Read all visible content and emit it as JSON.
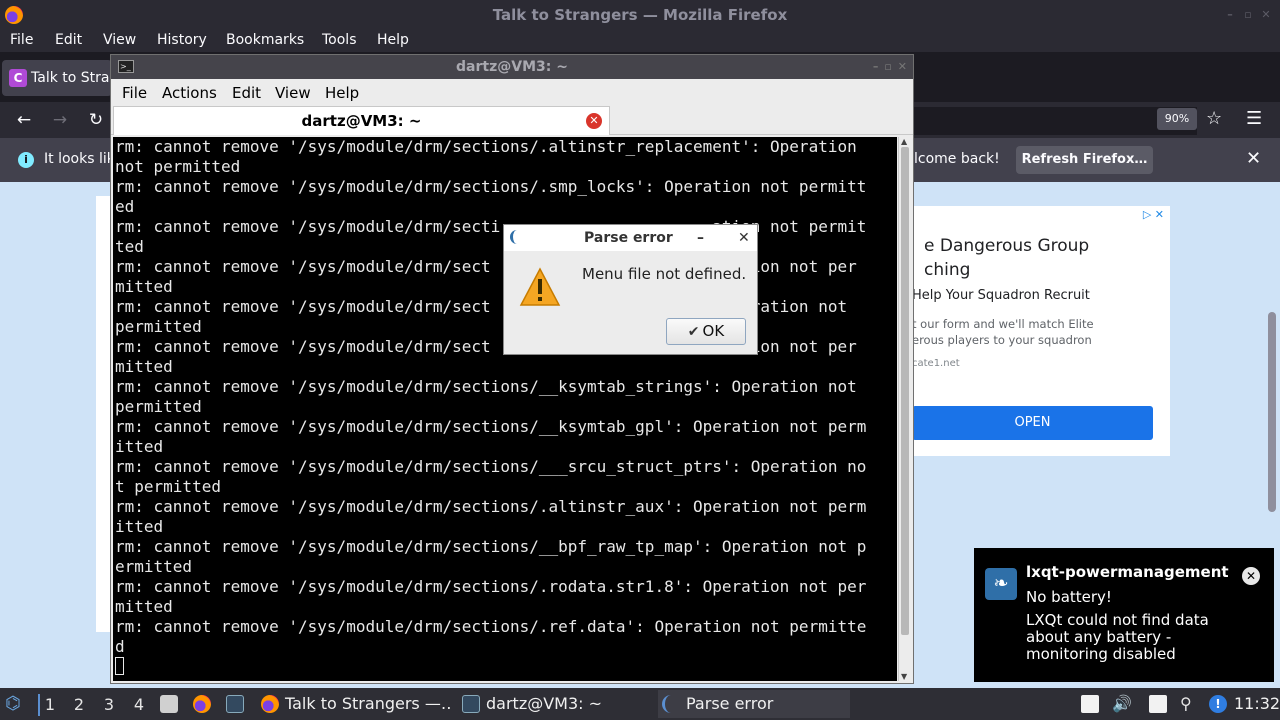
{
  "firefox": {
    "window_title": "Talk to Strangers — Mozilla Firefox",
    "menu": [
      "File",
      "Edit",
      "View",
      "History",
      "Bookmarks",
      "Tools",
      "Help"
    ],
    "tab_title": "Talk to Strangers",
    "tab_favicon_letter": "C",
    "zoom": "90%",
    "notice": {
      "text_left": "It looks like",
      "text_right": "lcome back!",
      "button": "Refresh Firefox…"
    }
  },
  "ad": {
    "adchoices": "▷ ✕",
    "title": "e Dangerous Group\nching",
    "subtitle": "Help Your Squadron Recruit",
    "body": "t our form and we'll match Elite\nerous players to your squadron",
    "domain": "cate1.net",
    "button": "OPEN"
  },
  "terminal": {
    "window_title": "dartz@VM3: ~",
    "menu": [
      "File",
      "Actions",
      "Edit",
      "View",
      "Help"
    ],
    "tab_title": "dartz@VM3: ~",
    "lines": [
      "rm: cannot remove '/sys/module/drm/sections/.altinstr_replacement': Operation",
      "not permitted",
      "rm: cannot remove '/sys/module/drm/sections/.smp_locks': Operation not permitt",
      "ed",
      "rm: cannot remove '/sys/module/drm/secti                      ation not permit",
      "ted",
      "rm: cannot remove '/sys/module/drm/sect                        ration not per",
      "mitted",
      "rm: cannot remove '/sys/module/drm/sect                        Operation not",
      "permitted",
      "rm: cannot remove '/sys/module/drm/sect                        ration not per",
      "mitted",
      "rm: cannot remove '/sys/module/drm/sections/__ksymtab_strings': Operation not",
      "permitted",
      "rm: cannot remove '/sys/module/drm/sections/__ksymtab_gpl': Operation not perm",
      "itted",
      "rm: cannot remove '/sys/module/drm/sections/___srcu_struct_ptrs': Operation no",
      "t permitted",
      "rm: cannot remove '/sys/module/drm/sections/.altinstr_aux': Operation not perm",
      "itted",
      "rm: cannot remove '/sys/module/drm/sections/__bpf_raw_tp_map': Operation not p",
      "ermitted",
      "rm: cannot remove '/sys/module/drm/sections/.rodata.str1.8': Operation not per",
      "mitted",
      "rm: cannot remove '/sys/module/drm/sections/.ref.data': Operation not permitte",
      "d"
    ]
  },
  "dialog": {
    "title": "Parse error",
    "message": "Menu file not defined.",
    "ok_label": "OK"
  },
  "notification": {
    "title": "lxqt-powermanagement",
    "subtitle": "No battery!",
    "body": "LXQt could not find data about any battery - monitoring disabled"
  },
  "panel": {
    "desktops": [
      "1",
      "2",
      "3",
      "4"
    ],
    "tasks": [
      {
        "label": "Talk to Strangers —…"
      },
      {
        "label": "dartz@VM3: ~"
      },
      {
        "label": "Parse error"
      }
    ],
    "clock": "11:32"
  }
}
